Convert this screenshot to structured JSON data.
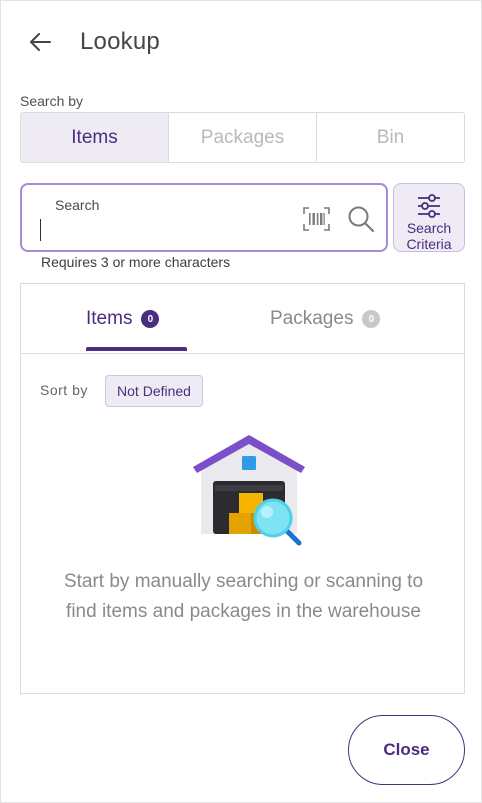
{
  "header": {
    "title": "Lookup"
  },
  "search_by": {
    "label": "Search by",
    "options": [
      {
        "label": "Items",
        "active": true
      },
      {
        "label": "Packages",
        "active": false
      },
      {
        "label": "Bin",
        "active": false
      }
    ]
  },
  "search": {
    "label": "Search",
    "value": "",
    "hint": "Requires 3 or more characters"
  },
  "criteria": {
    "label_line1": "Search",
    "label_line2": "Criteria"
  },
  "results": {
    "tabs": [
      {
        "label": "Items",
        "count": "0",
        "active": true
      },
      {
        "label": "Packages",
        "count": "0",
        "active": false
      }
    ],
    "sort_label": "Sort by",
    "sort_value": "Not Defined",
    "empty_message": "Start by manually searching or scanning to find items and packages in the warehouse"
  },
  "footer": {
    "close_label": "Close"
  },
  "colors": {
    "accent": "#4a2d7f",
    "accent_light": "#eeebf5",
    "focus_border": "#a78bd6"
  },
  "icons": [
    "back-arrow-icon",
    "barcode-icon",
    "search-icon",
    "sliders-icon",
    "warehouse-illustration"
  ]
}
